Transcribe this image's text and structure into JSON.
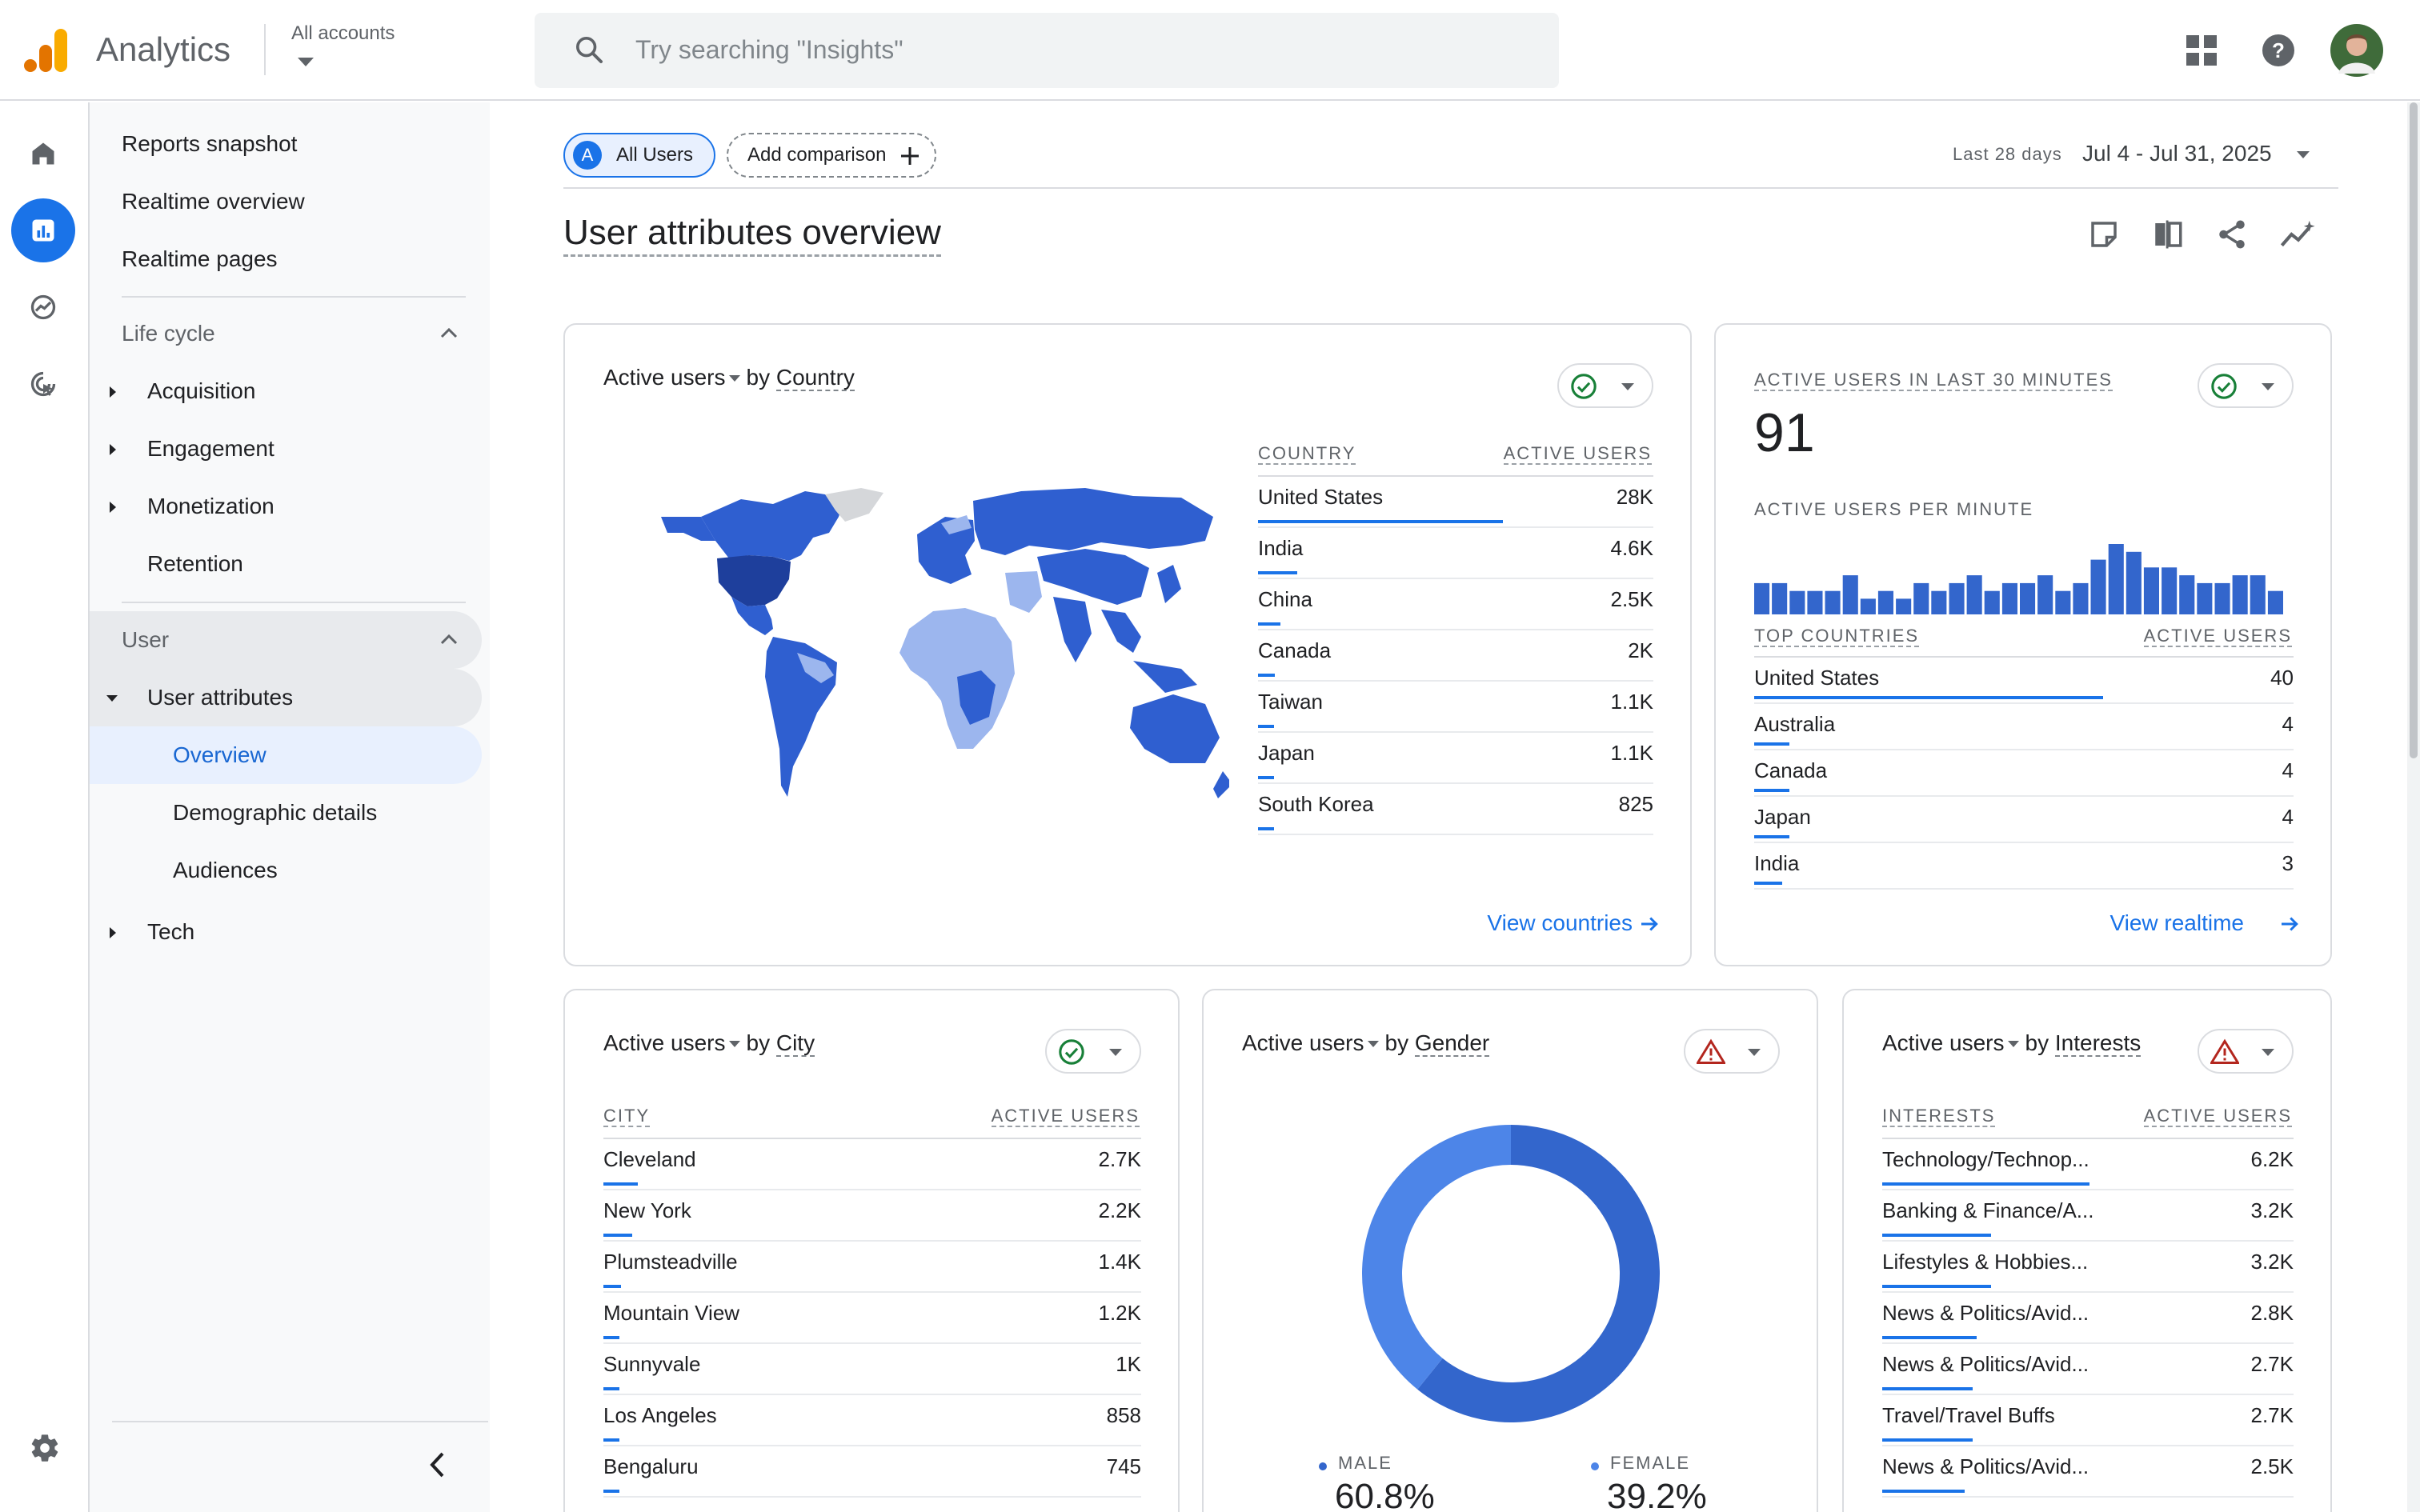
{
  "header": {
    "app_name": "Analytics",
    "account_label": "All accounts",
    "search_placeholder": "Try searching \"Insights\""
  },
  "sidebar": {
    "reports_snapshot": "Reports snapshot",
    "realtime_overview": "Realtime overview",
    "realtime_pages": "Realtime pages",
    "lifecycle": {
      "label": "Life cycle",
      "items": [
        "Acquisition",
        "Engagement",
        "Monetization",
        "Retention"
      ]
    },
    "user": {
      "label": "User",
      "user_attributes": "User attributes",
      "subitems": [
        "Overview",
        "Demographic details",
        "Audiences"
      ],
      "tech": "Tech"
    }
  },
  "toolbar": {
    "segment_letter": "A",
    "segment_label": "All Users",
    "add_comparison": "Add comparison",
    "date_prefix": "Last 28 days",
    "date_range": "Jul 4 - Jul 31, 2025"
  },
  "page_title": "User attributes overview",
  "country_card": {
    "metric": "Active users",
    "by": "by",
    "dimension": "Country",
    "col_dim": "COUNTRY",
    "col_metric": "ACTIVE USERS",
    "rows": [
      {
        "label": "United States",
        "value": "28K",
        "share": 1.0
      },
      {
        "label": "India",
        "value": "4.6K",
        "share": 0.16
      },
      {
        "label": "China",
        "value": "2.5K",
        "share": 0.09
      },
      {
        "label": "Canada",
        "value": "2K",
        "share": 0.07
      },
      {
        "label": "Taiwan",
        "value": "1.1K",
        "share": 0.04
      },
      {
        "label": "Japan",
        "value": "1.1K",
        "share": 0.04
      },
      {
        "label": "South Korea",
        "value": "825",
        "share": 0.03
      }
    ],
    "link": "View countries"
  },
  "realtime_card": {
    "title": "ACTIVE USERS IN LAST 30 MINUTES",
    "count": "91",
    "per_minute_label": "ACTIVE USERS PER MINUTE",
    "per_minute": [
      4,
      4,
      3,
      3,
      3,
      5,
      2,
      3,
      2,
      4,
      3,
      4,
      5,
      3,
      4,
      4,
      5,
      3,
      4,
      7,
      9,
      8,
      6,
      6,
      5,
      4,
      4,
      5,
      5,
      3
    ],
    "col_dim": "TOP COUNTRIES",
    "col_metric": "ACTIVE USERS",
    "rows": [
      {
        "label": "United States",
        "value": "40",
        "share": 1.0
      },
      {
        "label": "Australia",
        "value": "4",
        "share": 0.1
      },
      {
        "label": "Canada",
        "value": "4",
        "share": 0.1
      },
      {
        "label": "Japan",
        "value": "4",
        "share": 0.1
      },
      {
        "label": "India",
        "value": "3",
        "share": 0.08
      }
    ],
    "link": "View realtime"
  },
  "city_card": {
    "metric": "Active users",
    "by": "by",
    "dimension": "City",
    "col_dim": "CITY",
    "col_metric": "ACTIVE USERS",
    "rows": [
      {
        "label": "Cleveland",
        "value": "2.7K",
        "share": 0.12
      },
      {
        "label": "New York",
        "value": "2.2K",
        "share": 0.1
      },
      {
        "label": "Plumsteadville",
        "value": "1.4K",
        "share": 0.06
      },
      {
        "label": "Mountain View",
        "value": "1.2K",
        "share": 0.05
      },
      {
        "label": "Sunnyvale",
        "value": "1K",
        "share": 0.045
      },
      {
        "label": "Los Angeles",
        "value": "858",
        "share": 0.04
      },
      {
        "label": "Bengaluru",
        "value": "745",
        "share": 0.035
      }
    ]
  },
  "gender_card": {
    "metric": "Active users",
    "by": "by",
    "dimension": "Gender",
    "legend": [
      {
        "label": "MALE",
        "value": "60.8%",
        "pct": 60.8,
        "color": "#3366cc"
      },
      {
        "label": "FEMALE",
        "value": "39.2%",
        "pct": 39.2,
        "color": "#4d85e8"
      }
    ]
  },
  "interests_card": {
    "metric": "Active users",
    "by": "by",
    "dimension": "Interests",
    "col_dim": "INTERESTS",
    "col_metric": "ACTIVE USERS",
    "rows": [
      {
        "label": "Technology/Technop...",
        "value": "6.2K",
        "share": 0.55
      },
      {
        "label": "Banking & Finance/A...",
        "value": "3.2K",
        "share": 0.29
      },
      {
        "label": "Lifestyles & Hobbies...",
        "value": "3.2K",
        "share": 0.29
      },
      {
        "label": "News & Politics/Avid...",
        "value": "2.8K",
        "share": 0.25
      },
      {
        "label": "News & Politics/Avid...",
        "value": "2.7K",
        "share": 0.24
      },
      {
        "label": "Travel/Travel Buffs",
        "value": "2.7K",
        "share": 0.24
      },
      {
        "label": "News & Politics/Avid...",
        "value": "2.5K",
        "share": 0.22
      }
    ]
  },
  "colors": {
    "accent": "#1a73e8",
    "map_dark": "#1e3f9c",
    "map_mid": "#2f5fd0",
    "map_light": "#9cb6ee",
    "map_none": "#d5d7da",
    "warning": "#e37400",
    "success": "#188038"
  }
}
